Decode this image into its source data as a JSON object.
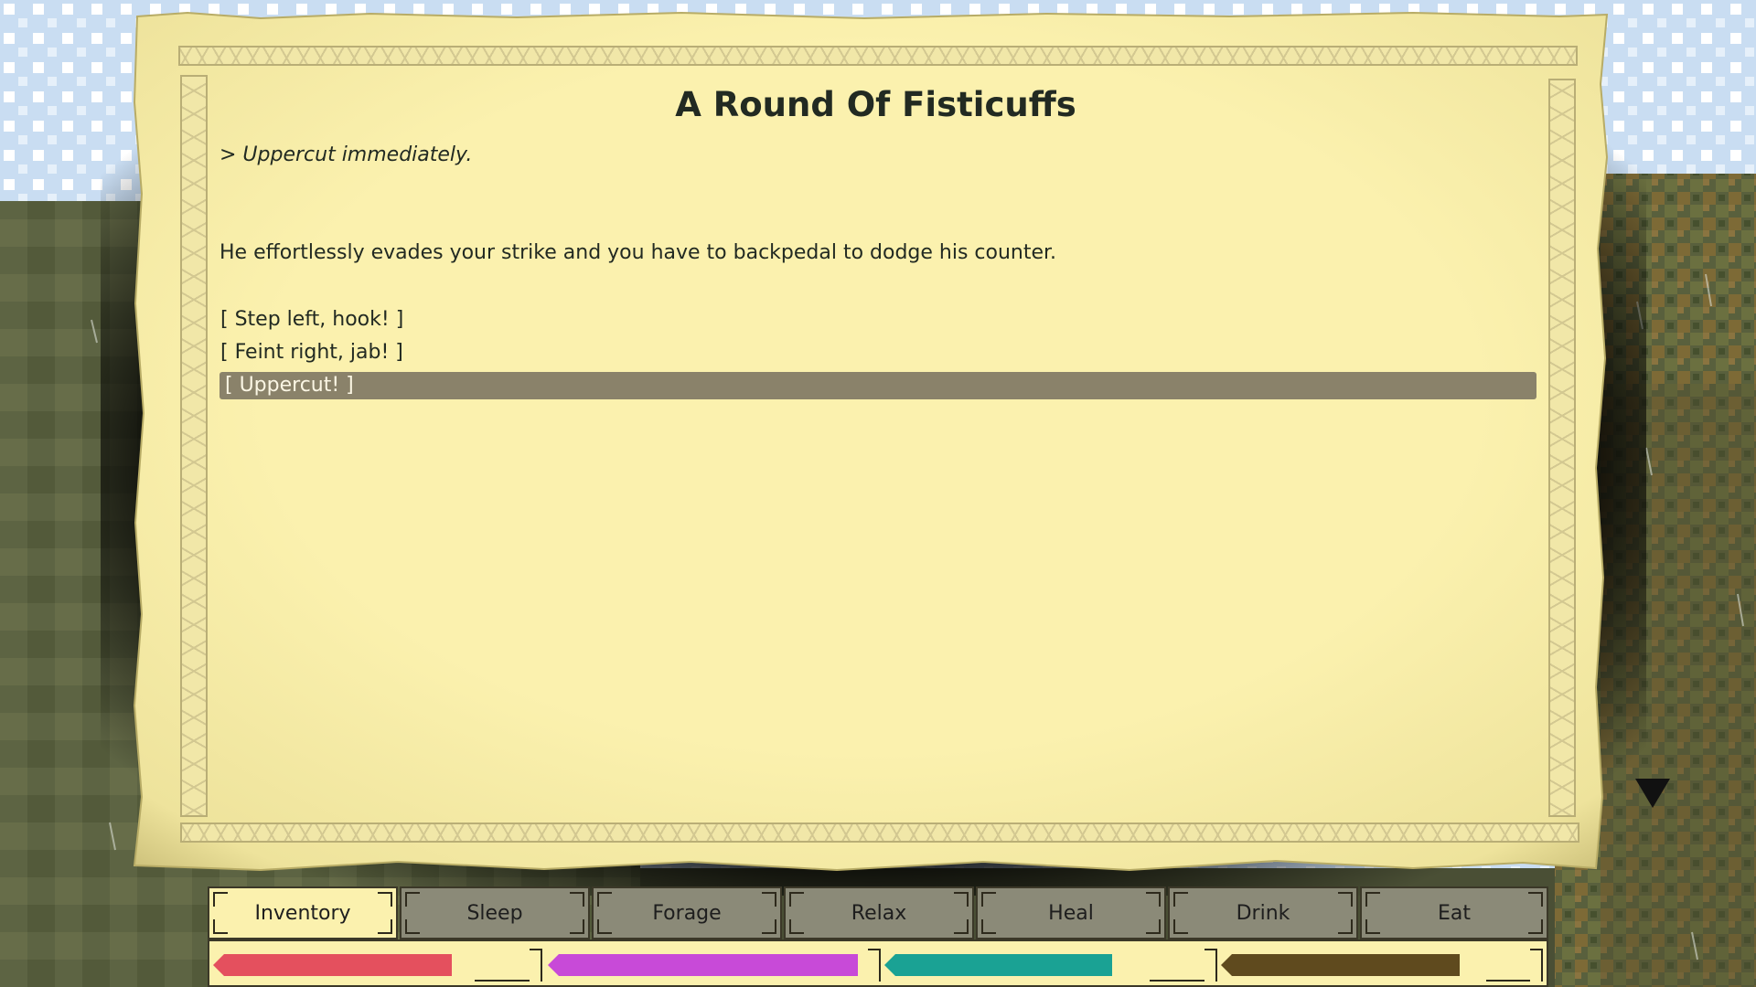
{
  "story": {
    "title": "A Round Of Fisticuffs",
    "player_action": "> Uppercut immediately.",
    "narrative": "He effortlessly evades your strike and you have to backpedal to dodge his counter.",
    "choices": [
      {
        "label": "[ Step left, hook! ]",
        "selected": false
      },
      {
        "label": "[ Feint right, jab! ]",
        "selected": false
      },
      {
        "label": "[ Uppercut! ]",
        "selected": true
      }
    ],
    "more_indicator_icon": "down-triangle-icon"
  },
  "action_bar": {
    "tabs": [
      {
        "label": "Inventory",
        "active": true
      },
      {
        "label": "Sleep",
        "active": false
      },
      {
        "label": "Forage",
        "active": false
      },
      {
        "label": "Relax",
        "active": false
      },
      {
        "label": "Heal",
        "active": false
      },
      {
        "label": "Drink",
        "active": false
      },
      {
        "label": "Eat",
        "active": false
      }
    ],
    "meters": [
      {
        "color": "#e4505e",
        "level": 0.76
      },
      {
        "color": "#c84ad8",
        "level": 0.98
      },
      {
        "color": "#1aa294",
        "level": 0.72
      },
      {
        "color": "#5f4a1e",
        "level": 0.78
      }
    ]
  },
  "colors": {
    "parchment": "#fbf1ae",
    "highlight": "#8a826a",
    "text": "#222a22",
    "sky": "#c9ddf2",
    "grass": "#6d7548"
  }
}
